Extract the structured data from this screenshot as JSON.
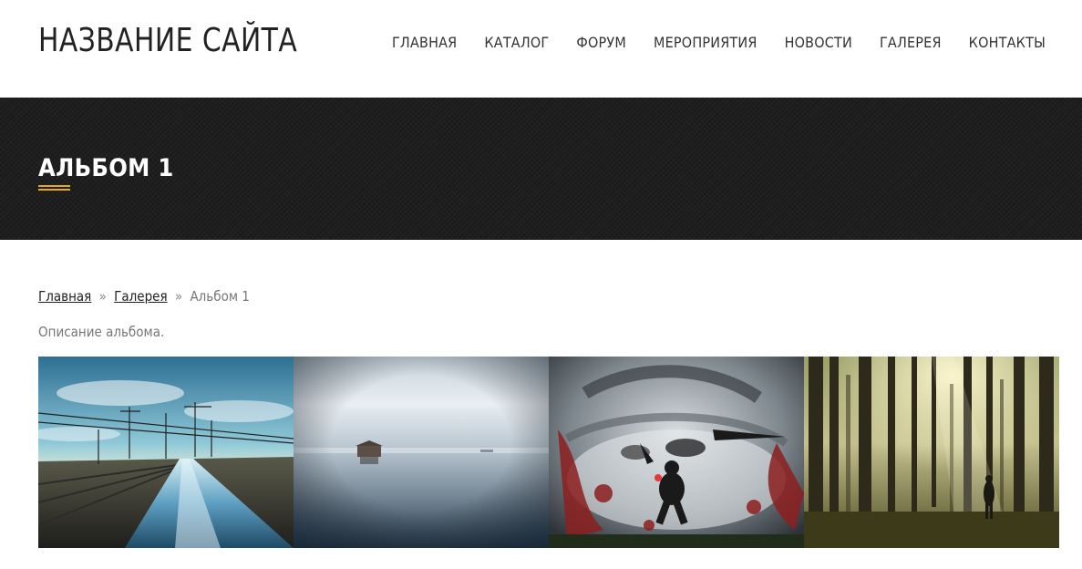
{
  "header": {
    "site_title": "НАЗВАНИЕ САЙТА",
    "nav": [
      {
        "label": "ГЛАВНАЯ"
      },
      {
        "label": "КАТАЛОГ"
      },
      {
        "label": "ФОРУМ"
      },
      {
        "label": "МЕРОПРИЯТИЯ"
      },
      {
        "label": "НОВОСТИ"
      },
      {
        "label": "ГАЛЕРЕЯ"
      },
      {
        "label": "КОНТАКТЫ"
      }
    ]
  },
  "banner": {
    "page_title": "АЛЬБОМ 1",
    "accent_color": "#e6a823"
  },
  "breadcrumb": {
    "home": "Главная",
    "separator": "»",
    "gallery": "Галерея",
    "current": "Альбом 1"
  },
  "album": {
    "description": "Описание альбома.",
    "photos": [
      {
        "icon": "railway-photo"
      },
      {
        "icon": "foggy-lake-photo"
      },
      {
        "icon": "battle-art-photo"
      },
      {
        "icon": "forest-photo"
      }
    ]
  }
}
